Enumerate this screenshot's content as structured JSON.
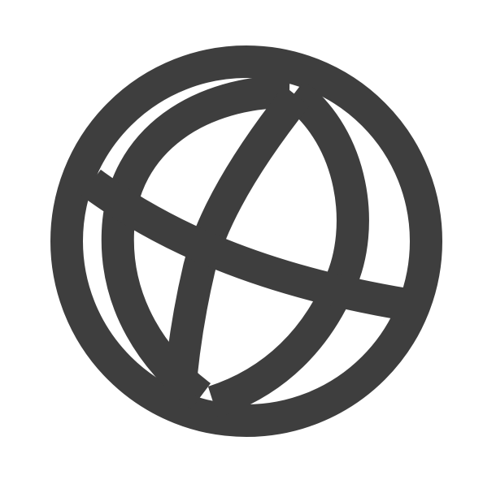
{
  "icon": {
    "name": "globe-icon",
    "color": "#3e3e3e",
    "background": "#ffffff"
  }
}
